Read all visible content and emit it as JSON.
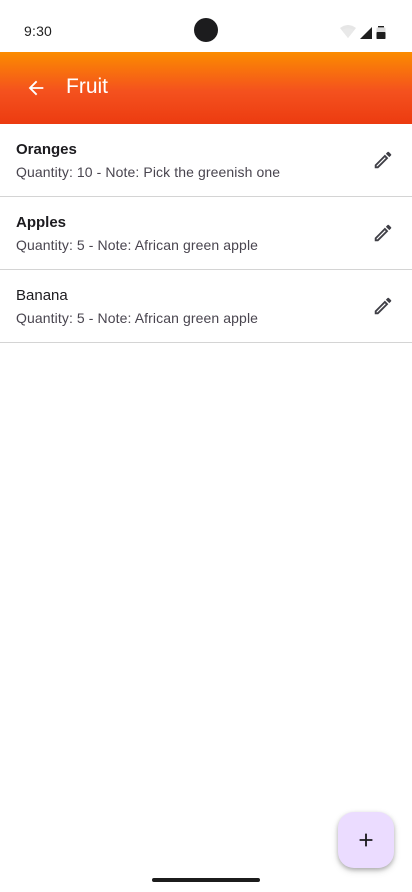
{
  "status_bar": {
    "time": "9:30"
  },
  "app_bar": {
    "title": "Fruit",
    "colors": {
      "gradient_top": "#fb8c00",
      "gradient_bottom": "#ec3b10"
    }
  },
  "items": [
    {
      "name": "Oranges",
      "details": "Quantity: 10 - Note: Pick the greenish one"
    },
    {
      "name": "Apples",
      "details": "Quantity: 5 - Note: African green apple"
    },
    {
      "name": "Banana",
      "details": "Quantity: 5 - Note: African green apple"
    }
  ],
  "icons": {
    "back": "arrow-back-icon",
    "edit": "pencil-icon",
    "add": "plus-icon"
  },
  "fab": {
    "color": "#ebdcff"
  }
}
